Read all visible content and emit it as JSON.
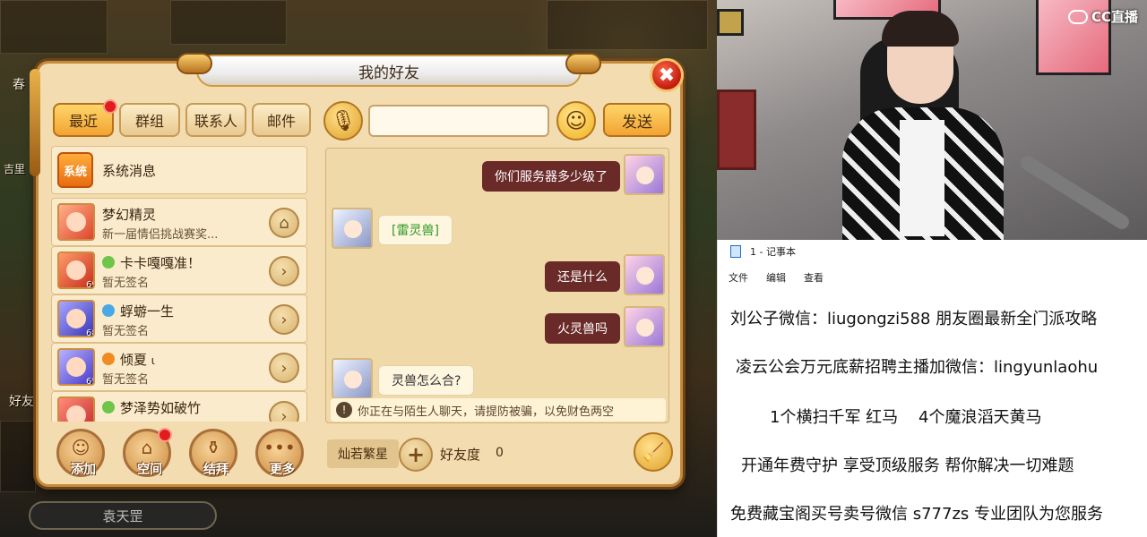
{
  "friend_window": {
    "title": "我的好友",
    "close_label": "✖",
    "tabs": [
      {
        "label": "最近",
        "active": true,
        "has_badge": true
      },
      {
        "label": "群组",
        "active": false,
        "has_badge": false
      },
      {
        "label": "联系人",
        "active": false,
        "has_badge": false
      },
      {
        "label": "邮件",
        "active": false,
        "has_badge": false
      }
    ],
    "friends": [
      {
        "name": "系统消息",
        "subtitle": "",
        "level": "",
        "badge": "系统",
        "type": "system"
      },
      {
        "name": "梦幻精灵",
        "subtitle": "新一届情侣挑战赛奖...",
        "level": "",
        "type": "npc",
        "action_icon": "home-icon"
      },
      {
        "name": "卡卡嘎嘎准！",
        "subtitle": "暂无签名",
        "level": "69",
        "type": "player",
        "action_icon": "arrow-right-icon"
      },
      {
        "name": "蜉蝣一生",
        "subtitle": "暂无签名",
        "level": "68",
        "type": "player",
        "action_icon": "arrow-right-icon"
      },
      {
        "name": "倾夏",
        "name_suffix": "ι",
        "subtitle": "暂无签名",
        "level": "65",
        "type": "player",
        "action_icon": "arrow-right-icon"
      },
      {
        "name": "梦泽势如破竹",
        "subtitle": "",
        "level": "",
        "type": "player",
        "action_icon": "arrow-right-icon"
      }
    ],
    "bottom_buttons": [
      {
        "label": "添加",
        "icon": "add-friend-icon"
      },
      {
        "label": "空间",
        "icon": "house-icon",
        "has_badge": true
      },
      {
        "label": "结拜",
        "icon": "jar-icon"
      },
      {
        "label": "更多",
        "icon": "more-icon"
      }
    ],
    "chat": {
      "input_value": "",
      "send_label": "发送",
      "messages": [
        {
          "direction": "out",
          "text": "你们服务器多少级了",
          "highlight": false
        },
        {
          "direction": "in",
          "text": "[雷灵兽]",
          "highlight": true
        },
        {
          "direction": "out",
          "text": "还是什么",
          "highlight": false
        },
        {
          "direction": "out",
          "text": "火灵兽吗",
          "highlight": false
        },
        {
          "direction": "in",
          "text": "灵兽怎么合?",
          "highlight": false
        }
      ],
      "warning": "你正在与陌生人聊天，请提防被骗，以免财色两空",
      "warning_icon": "!",
      "friend_name": "灿若繁星",
      "favor_label": "好友度",
      "favor_value": "0"
    }
  },
  "game_bg": {
    "nameplate": "袁天罡",
    "side_labels": [
      "春",
      "好友",
      "吉里"
    ]
  },
  "webcam": {
    "brand": "CC直播"
  },
  "notepad": {
    "title": "1 - 记事本",
    "menu": [
      "文件",
      "编辑",
      "查看"
    ],
    "lines": [
      "刘公子微信：liugongzi588 朋友圈最新全门派攻略",
      "凌云公会万元底薪招聘主播加微信：lingyunlaohu",
      "1个横扫千军 红马    4个魔浪滔天黄马",
      "开通年费守护 享受顶级服务 帮你解决一切难题",
      "免费藏宝阁买号卖号微信 s777zs 专业团队为您服务"
    ]
  }
}
